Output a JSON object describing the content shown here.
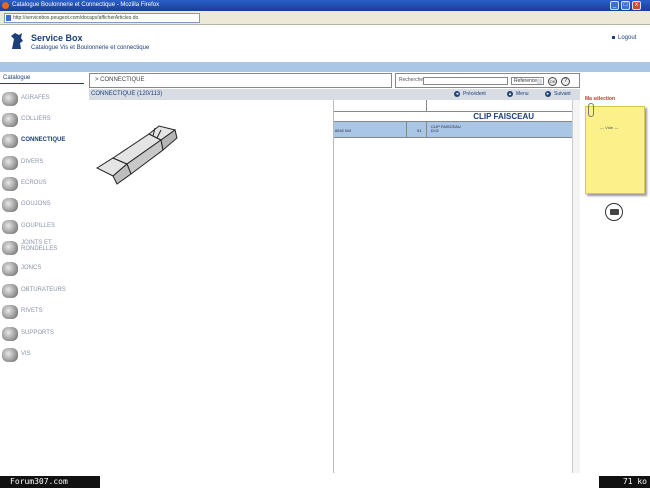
{
  "window": {
    "title": "Catalogue Boulonnerie et Connectique - Mozilla Firefox",
    "url": "http://servicebox.peugeot.com/docapv/afficherArticles.do",
    "controls": [
      "_",
      "□",
      "x"
    ]
  },
  "header": {
    "title": "Service Box",
    "subtitle": "Catalogue Vis et Boulonnerie et connectique",
    "logout": "Logout"
  },
  "sidebar": {
    "heading": "Catalogue",
    "items": [
      {
        "label": "AGRAFES",
        "icon": "agrafe-icon"
      },
      {
        "label": "COLLIERS",
        "icon": "collier-icon"
      },
      {
        "label": "CONNECTIQUE",
        "icon": "connectique-icon",
        "active": true
      },
      {
        "label": "DIVERS",
        "icon": "divers-icon"
      },
      {
        "label": "ECROUS",
        "icon": "ecrou-icon"
      },
      {
        "label": "GOUJONS",
        "icon": "goujon-icon"
      },
      {
        "label": "GOUPILLES",
        "icon": "goupille-icon"
      },
      {
        "label": "JOINTS ET",
        "label2": "RONDELLES",
        "icon": "joint-icon"
      },
      {
        "label": "JONCS",
        "icon": "jonc-icon"
      },
      {
        "label": "OBTURATEURS",
        "icon": "obturateur-icon"
      },
      {
        "label": "RIVETS",
        "icon": "rivet-icon"
      },
      {
        "label": "SUPPORTS",
        "icon": "support-icon"
      },
      {
        "label": "VIS",
        "icon": "vis-icon"
      }
    ]
  },
  "breadcrumb": "> CONNECTIQUE",
  "search": {
    "label": "Recherche",
    "select_value": "Reference",
    "ok_label": "OK",
    "help_label": "?"
  },
  "nav": {
    "section": "CONNECTIQUE (120/113)",
    "prev": "Précédent",
    "menu": "Menu",
    "next": "Suivant"
  },
  "table": {
    "title": "CLIP FAISCEAU",
    "rows": [
      {
        "ref": "6542 W4",
        "qty": "01",
        "desc": "CLIP FAISCEAU",
        "desc2": "D=5"
      }
    ]
  },
  "rpanel": {
    "title": "Ma sélection",
    "postit_text": "— Vide —"
  },
  "footer": {
    "left": "Forum307.com",
    "right": "71 ko"
  }
}
